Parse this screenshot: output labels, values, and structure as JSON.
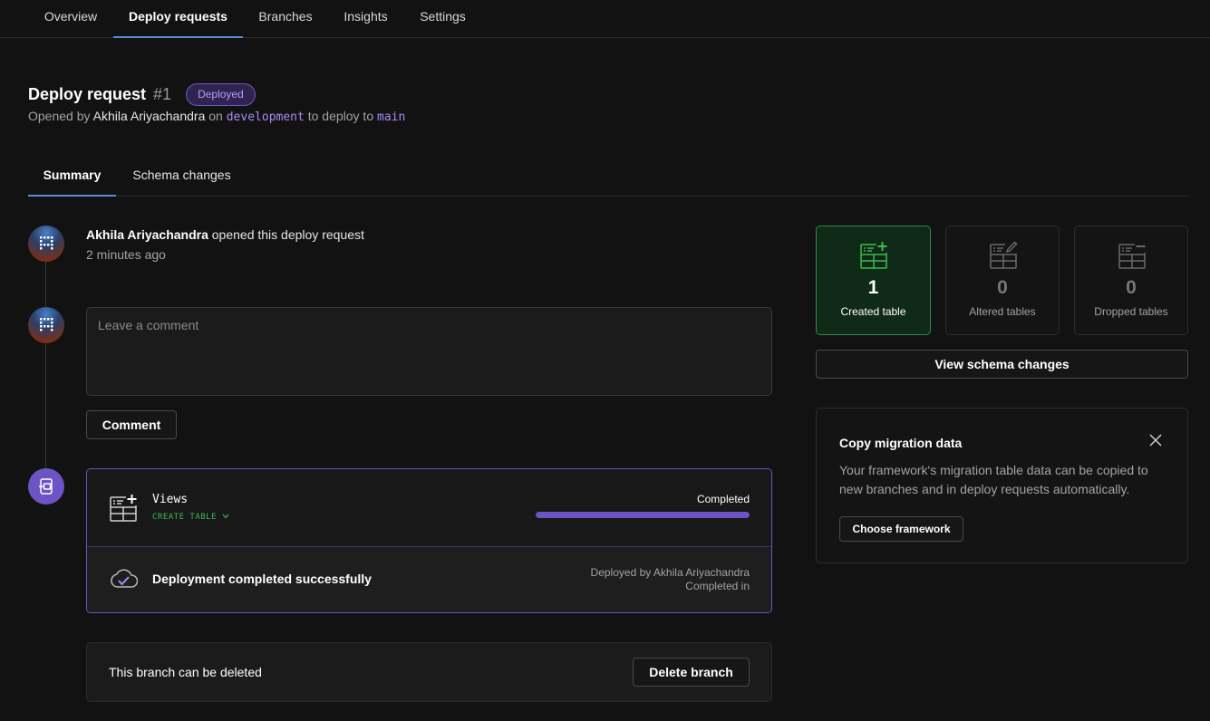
{
  "nav": {
    "tabs": [
      {
        "label": "Overview"
      },
      {
        "label": "Deploy requests"
      },
      {
        "label": "Branches"
      },
      {
        "label": "Insights"
      },
      {
        "label": "Settings"
      }
    ],
    "active": "Deploy requests"
  },
  "header": {
    "title": "Deploy request",
    "number": "#1",
    "status": "Deployed",
    "opened_by_prefix": "Opened by",
    "author": "Akhila Ariyachandra",
    "on_text": "on",
    "source_branch": "development",
    "deploy_to_text": "to deploy to",
    "target_branch": "main"
  },
  "subtabs": [
    {
      "label": "Summary"
    },
    {
      "label": "Schema changes"
    }
  ],
  "timeline": {
    "opened_event": {
      "author": "Akhila Ariyachandra",
      "action": "opened this deploy request",
      "time": "2 minutes ago"
    },
    "comment": {
      "placeholder": "Leave a comment",
      "button": "Comment"
    },
    "deployment": {
      "table_name": "Views",
      "operation": "CREATE TABLE",
      "status": "Completed",
      "progress": 1.0,
      "success_message": "Deployment completed successfully",
      "deployed_by": "Deployed by Akhila Ariyachandra",
      "completed_in": "Completed in"
    },
    "branch": {
      "message": "This branch can be deleted",
      "button": "Delete branch"
    }
  },
  "stats": [
    {
      "count": "1",
      "label": "Created table",
      "icon": "table-add-icon"
    },
    {
      "count": "0",
      "label": "Altered tables",
      "icon": "table-edit-icon"
    },
    {
      "count": "0",
      "label": "Dropped tables",
      "icon": "table-remove-icon"
    }
  ],
  "view_schema_button": "View schema changes",
  "migration": {
    "title": "Copy migration data",
    "description": "Your framework's migration table data can be copied to new branches and in deploy requests automatically.",
    "button": "Choose framework"
  },
  "colors": {
    "accent_purple": "#6c54c4",
    "created_green": "#3fb950",
    "tab_underline": "#5b8ad6"
  }
}
